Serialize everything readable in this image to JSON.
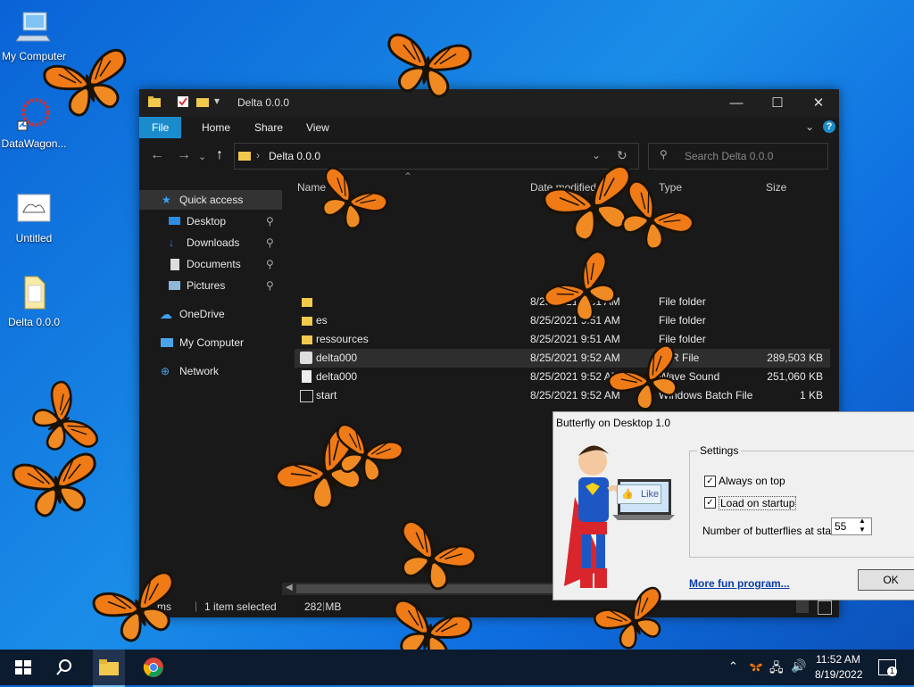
{
  "desktop": {
    "icons": [
      {
        "label": "My Computer"
      },
      {
        "label": "DataWagon..."
      },
      {
        "label": "Untitled"
      },
      {
        "label": "Delta 0.0.0"
      }
    ]
  },
  "explorer": {
    "title": "Delta 0.0.0",
    "tabs": [
      "File",
      "Home",
      "Share",
      "View"
    ],
    "address": "Delta 0.0.0",
    "search_placeholder": "Search Delta 0.0.0",
    "nav": {
      "quick_access": "Quick access",
      "pinned": [
        "Desktop",
        "Downloads",
        "Documents",
        "Pictures"
      ],
      "onedrive": "OneDrive",
      "mycomputer": "My Computer",
      "network": "Network"
    },
    "columns": [
      "Name",
      "Date modified",
      "Type",
      "Size"
    ],
    "files": [
      {
        "name": "",
        "date": "8/25/2021 9:51 AM",
        "type": "File folder",
        "size": ""
      },
      {
        "name": "es",
        "date": "8/25/2021 9:51 AM",
        "type": "File folder",
        "size": ""
      },
      {
        "name": "ressources",
        "date": "8/25/2021 9:51 AM",
        "type": "File folder",
        "size": ""
      },
      {
        "name": "delta000",
        "date": "8/25/2021 9:52 AM",
        "type": "JAR File",
        "size": "289,503 KB"
      },
      {
        "name": "delta000",
        "date": "8/25/2021 9:52 AM",
        "type": "Wave Sound",
        "size": "251,060 KB"
      },
      {
        "name": "start",
        "date": "8/25/2021 9:52 AM",
        "type": "Windows Batch File",
        "size": "1 KB"
      }
    ],
    "status": {
      "items": "ms",
      "selected": "1 item selected",
      "size": "282 MB"
    }
  },
  "dialog": {
    "title": "Butterfly on Desktop 1.0",
    "settings_label": "Settings",
    "always_on_top": "Always on top",
    "load_on_startup": "Load on startup",
    "count_label": "Number of butterflies at start",
    "count_value": "55",
    "like_label": "Like",
    "link": "More fun program...",
    "ok": "OK"
  },
  "taskbar": {
    "time": "11:52 AM",
    "date": "8/19/2022",
    "notif_count": "1"
  }
}
